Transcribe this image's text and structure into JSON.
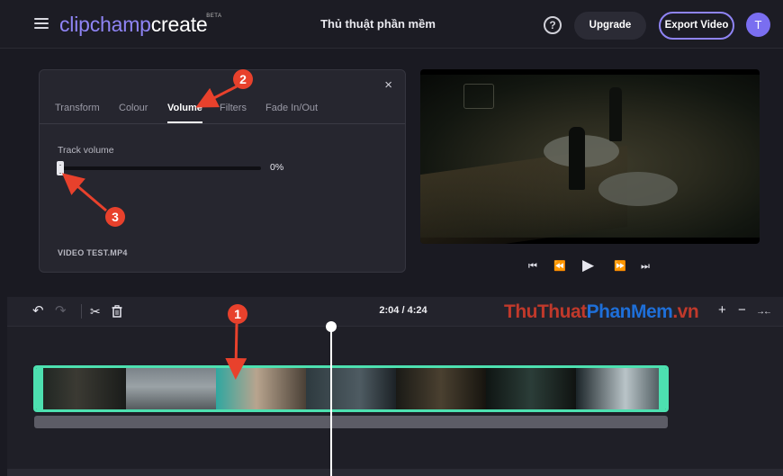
{
  "header": {
    "menu_icon": "hamburger-icon",
    "logo_clip": "clipchamp",
    "logo_create": "create",
    "logo_beta": "BETA",
    "project_title": "Thủ thuật phần mềm",
    "help_label": "?",
    "upgrade_label": "Upgrade",
    "export_label": "Export Video",
    "avatar_initial": "T"
  },
  "panel": {
    "close_glyph": "×",
    "tabs": [
      {
        "label": "Transform",
        "active": false
      },
      {
        "label": "Colour",
        "active": false
      },
      {
        "label": "Volume",
        "active": true
      },
      {
        "label": "Filters",
        "active": false
      },
      {
        "label": "Fade In/Out",
        "active": false
      }
    ],
    "track_volume_label": "Track volume",
    "track_volume_value": "0%",
    "track_volume_level": 0,
    "file_name": "VIDEO TEST.MP4"
  },
  "player": {
    "controls": [
      "skip-start-icon",
      "rewind-icon",
      "play-icon",
      "fast-forward-icon",
      "skip-end-icon"
    ]
  },
  "timeline": {
    "undo_icon": "undo-icon",
    "redo_icon": "redo-icon",
    "split_icon": "scissors-icon",
    "delete_icon": "trash-icon",
    "time_display": "2:04 / 4:24",
    "watermark_a": "ThuThuat",
    "watermark_b": "PhanMem",
    "watermark_c": ".vn",
    "zoom_in": "+",
    "zoom_out": "−",
    "fit": "→←"
  },
  "annotations": [
    {
      "number": "1",
      "color": "#e8412c"
    },
    {
      "number": "2",
      "color": "#e8412c"
    },
    {
      "number": "3",
      "color": "#e8412c"
    }
  ]
}
